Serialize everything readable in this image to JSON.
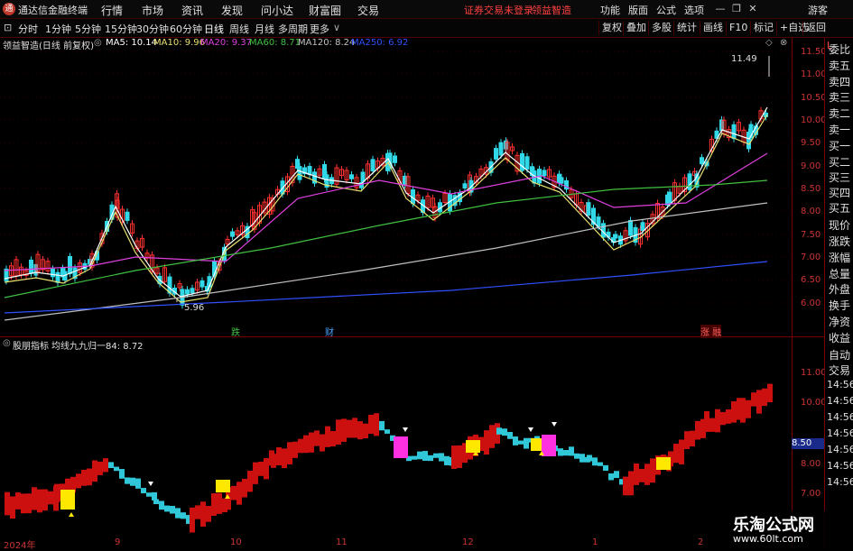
{
  "app": {
    "title": "通达信金融终端"
  },
  "menu": [
    "行情",
    "市场",
    "资讯",
    "发现",
    "问小达",
    "财富圈",
    "交易"
  ],
  "alerts": {
    "no_login": "证券交易未登录",
    "stock": "领益智造"
  },
  "right_menu": [
    "功能",
    "版面",
    "公式",
    "选项"
  ],
  "user": "游客",
  "periods": [
    "分时",
    "1分钟",
    "5分钟",
    "15分钟",
    "30分钟",
    "60分钟",
    "日线",
    "周线",
    "月线",
    "多周期",
    "更多"
  ],
  "active_period": "日线",
  "toolbar_right": [
    "复权",
    "叠加",
    "多股",
    "统计",
    "画线",
    "F10",
    "标记",
    "+自选",
    "返回"
  ],
  "main_header": {
    "stock": "领益智造(日线 前复权)",
    "ma": [
      {
        "label": "MA5: 10.14",
        "color": "#ffffff"
      },
      {
        "label": "MA10: 9.96",
        "color": "#e8e070"
      },
      {
        "label": "MA20: 9.37",
        "color": "#e040e0"
      },
      {
        "label": "MA60: 8.71",
        "color": "#40c040"
      },
      {
        "label": "MA120: 8.24",
        "color": "#c0c0c0"
      },
      {
        "label": "MA250: 6.92",
        "color": "#3050ff"
      }
    ]
  },
  "sub_header": {
    "name": "股朋指标",
    "label": "均线九九归一84: 8.72"
  },
  "annotations": {
    "high": "11.49",
    "low": "5.96",
    "evt1": "跌",
    "evt2": "财",
    "evt3": "涨 融"
  },
  "price_axis_main": [
    "11.50",
    "11.00",
    "10.50",
    "10.00",
    "9.50",
    "9.00",
    "8.50",
    "8.00",
    "7.50",
    "7.00",
    "6.50",
    "6.00"
  ],
  "price_axis_sub": [
    "11.00",
    "10.00",
    "8.00",
    "7.00"
  ],
  "current_value": "8.50",
  "date_axis": [
    "2024年",
    "9",
    "10",
    "11",
    "12",
    "1",
    "2"
  ],
  "right_panel": [
    "委比",
    "卖五",
    "卖四",
    "卖三",
    "卖二",
    "卖一",
    "买一",
    "买二",
    "买三",
    "买四",
    "买五",
    "现价",
    "涨跌",
    "涨幅",
    "总量",
    "外盘",
    "换手",
    "净资",
    "收益"
  ],
  "right_panel2": [
    "自动",
    "交易"
  ],
  "times": [
    "14:56",
    "14:56",
    "14:56",
    "14:56",
    "14:56",
    "14:56",
    "14:56"
  ],
  "watermark": {
    "line1": "乐淘公式网",
    "line2": "www.60lt.com"
  },
  "colors": {
    "up": "#ff3030",
    "down": "#30d0e0",
    "bg": "#000000",
    "grid": "#770000"
  }
}
